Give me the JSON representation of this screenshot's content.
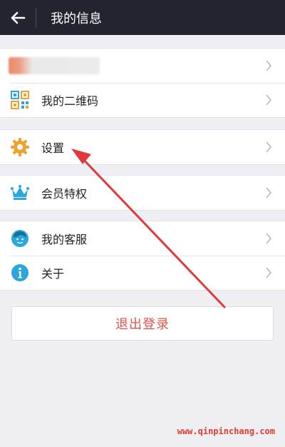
{
  "header": {
    "title": "我的信息"
  },
  "profile": {
    "name_visible": ""
  },
  "menu": {
    "qrcode_label": "我的二维码",
    "settings_label": "设置",
    "vip_label": "会员特权",
    "service_label": "我的客服",
    "about_label": "关于"
  },
  "logout_label": "退出登录",
  "watermark": "www.qinpinchang.com",
  "colors": {
    "header_bg": "#22252f",
    "accent_red": "#e0534a",
    "icon_blue": "#2aa7dd",
    "icon_orange": "#f0a030"
  },
  "icons": [
    "back-arrow-icon",
    "qrcode-icon",
    "gear-icon",
    "crown-icon",
    "service-icon",
    "info-icon",
    "chevron-right-icon"
  ]
}
